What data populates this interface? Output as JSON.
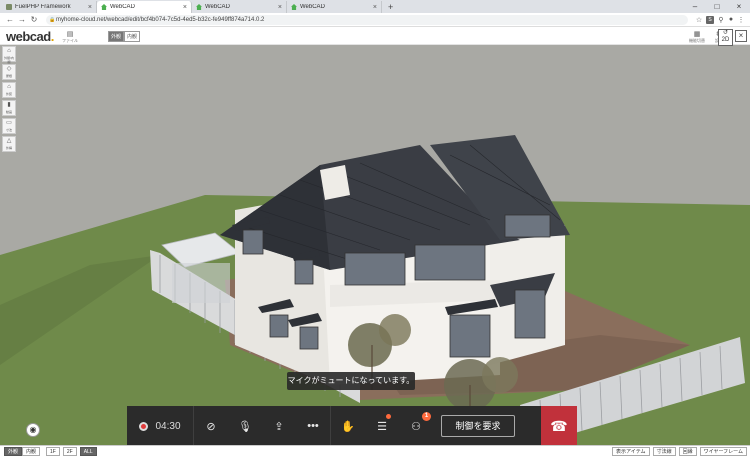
{
  "browser": {
    "tabs": [
      {
        "title": "FuelPHP Framework",
        "favicon": "gray",
        "active": false
      },
      {
        "title": "WebCAD",
        "favicon": "green",
        "active": true
      },
      {
        "title": "WebCAD",
        "favicon": "green",
        "active": false
      },
      {
        "title": "WebCAD",
        "favicon": "green",
        "active": false
      }
    ],
    "new_tab": "+",
    "url": "myhome-cloud.net/webcad/edit/bcf4b074-7c5d-4ed5-b32c-fe949ff874a714.0.2",
    "ext_badge": "S"
  },
  "header": {
    "logo_text": "webcad",
    "logo_dot": ".",
    "file_label": "ファイル",
    "view_toggle": [
      "外観",
      "内観"
    ],
    "right_buttons": [
      "機能切替",
      "設定"
    ],
    "close": "×",
    "view_2d_label": "2D"
  },
  "left_tools": [
    {
      "icon": "⌂",
      "label": "外観/内観"
    },
    {
      "icon": "◇",
      "label": "屋根"
    },
    {
      "icon": "⌂",
      "label": "外装"
    },
    {
      "icon": "▮",
      "label": "動画"
    },
    {
      "icon": "▭",
      "label": "寸法"
    },
    {
      "icon": "△",
      "label": "外構"
    }
  ],
  "toast": "マイクがミュートになっています。",
  "meeting": {
    "timer": "04:30",
    "participants_count": "1",
    "request_control_label": "制御を要求"
  },
  "statusbar": {
    "view_toggle": [
      "外観",
      "内観"
    ],
    "floors": [
      "1F",
      "2F",
      "ALL"
    ],
    "right_buttons": [
      "表示アイテム",
      "寸法線",
      "回縁",
      "ワイヤーフレーム"
    ]
  },
  "colors": {
    "sky": "#a7a7a2",
    "lawn": "#6f8a4a",
    "patio": "#8a6e5c",
    "roof": "#3a3d44",
    "wall": "#f2f0ec",
    "hangup": "#c1313b",
    "notification": "#ff6a3d"
  }
}
